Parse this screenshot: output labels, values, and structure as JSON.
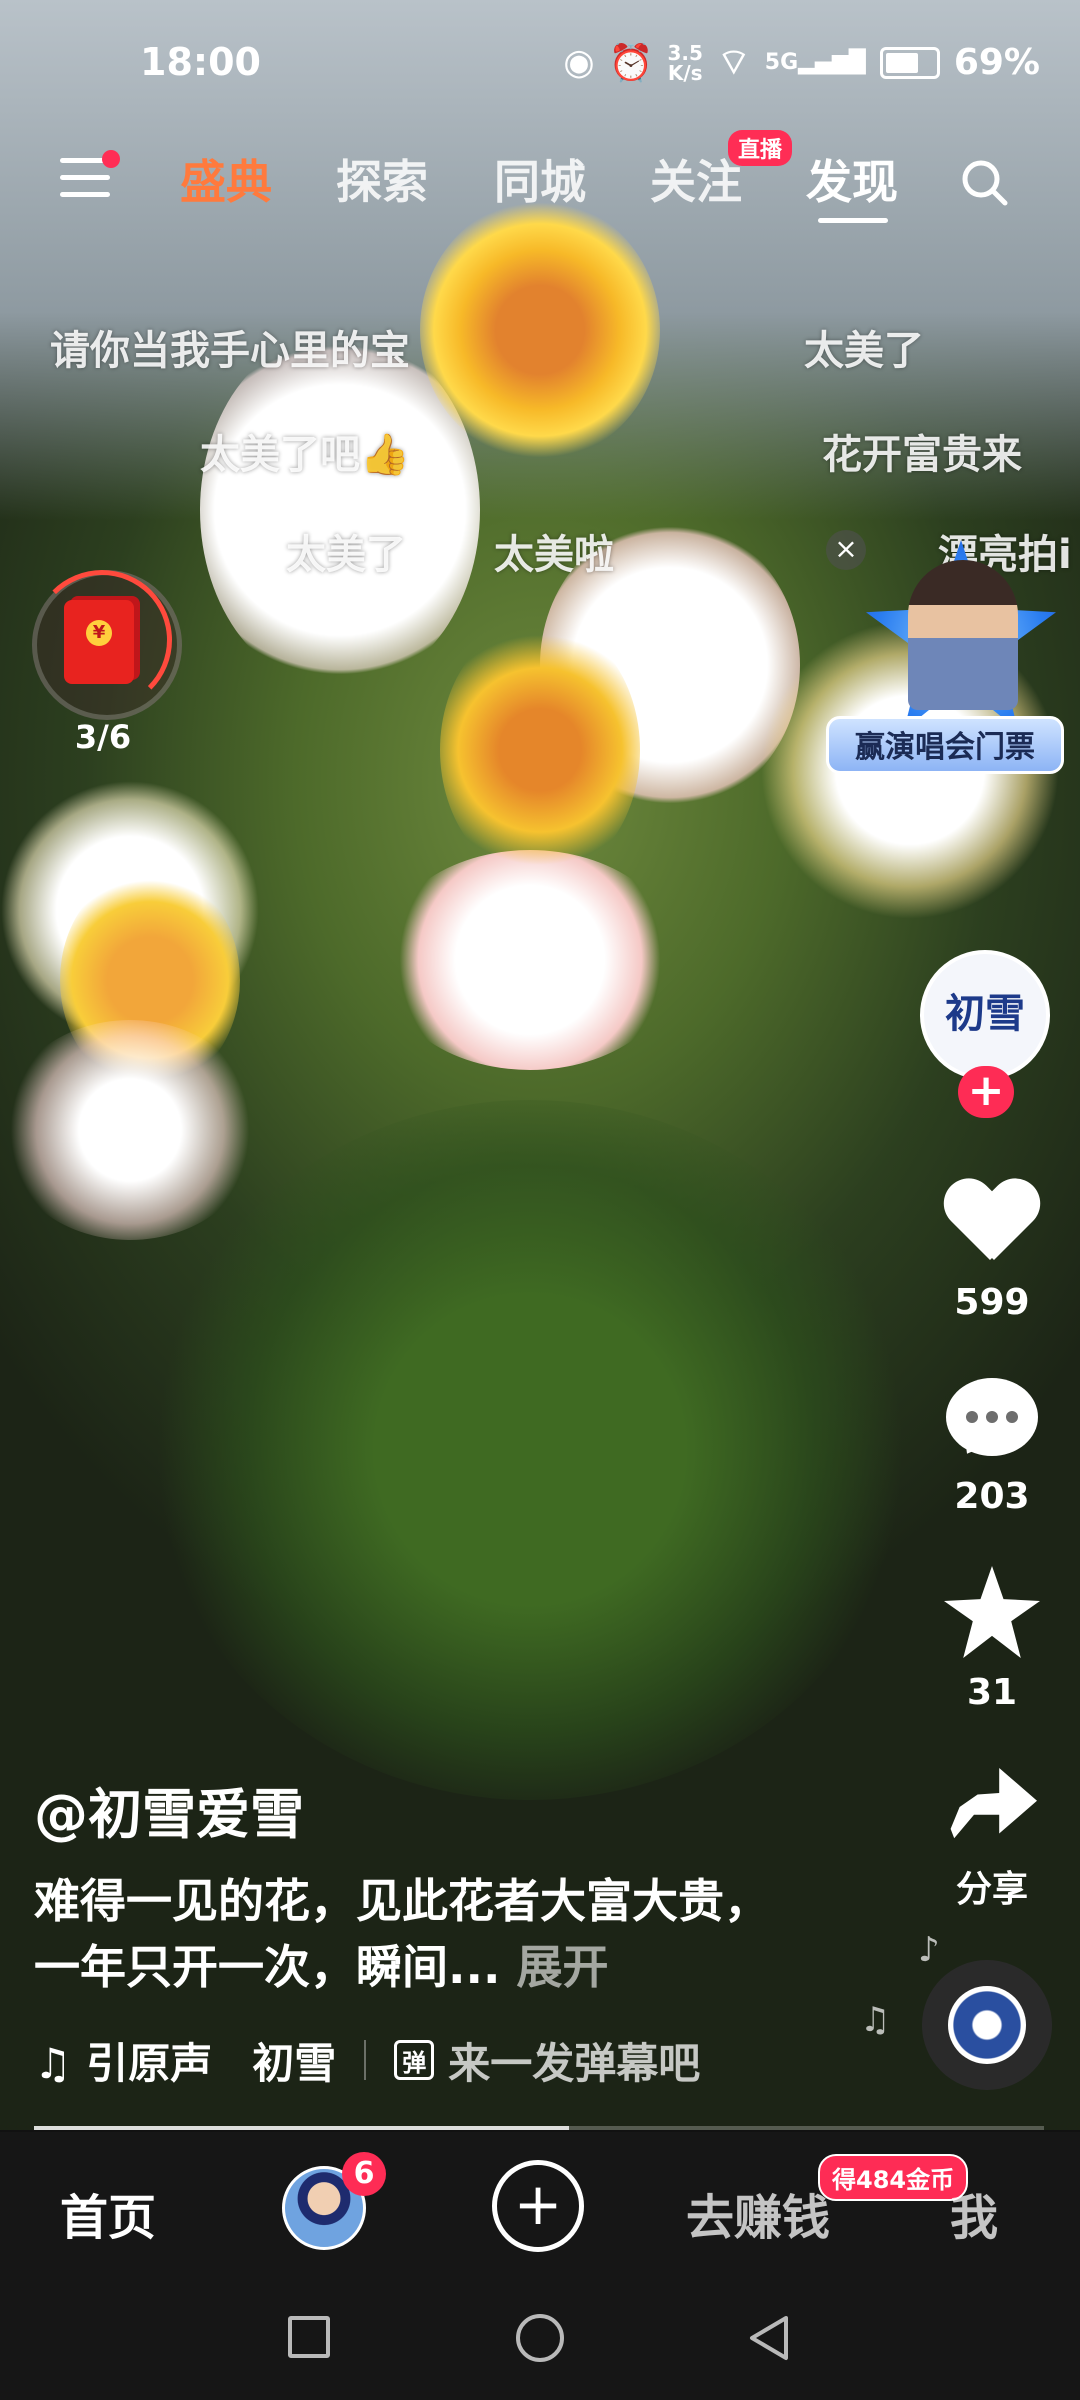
{
  "status_bar": {
    "time": "18:00",
    "speed_value": "3.5",
    "speed_unit": "K/s",
    "network": "5G",
    "battery": "69%"
  },
  "top_nav": {
    "tabs": [
      {
        "label": "盛典",
        "state": "hot"
      },
      {
        "label": "探索",
        "state": "normal"
      },
      {
        "label": "同城",
        "state": "normal"
      },
      {
        "label": "关注",
        "state": "normal"
      },
      {
        "label": "发现",
        "state": "active"
      }
    ],
    "live_badge": "直播"
  },
  "danmaku": [
    "请你当我手心里的宝",
    "太美了",
    "太美了吧👍",
    "花开富贵来",
    "太美了",
    "太美啦",
    "漂亮拍i"
  ],
  "red_packet": {
    "progress": "3/6"
  },
  "promo": {
    "label": "赢演唱会门票"
  },
  "creator": {
    "avatar_text": "初雪",
    "follow": "+"
  },
  "actions": {
    "likes": "599",
    "comments": "203",
    "favorites": "31",
    "share": "分享"
  },
  "video": {
    "author": "@初雪爱雪",
    "description": "难得一见的花，见此花者大富大贵，一年只开一次，瞬间...",
    "expand": "展开",
    "music_label": "♫ 引原声",
    "music_author": "初雪",
    "danmaku_prompt": "来一发弹幕吧",
    "danmaku_icon": "弹",
    "progress": 0.53
  },
  "bottom_nav": {
    "home": "首页",
    "friend_badge": "6",
    "create": "+",
    "earn": "去赚钱",
    "coins_badge": "得484金币",
    "me": "我"
  },
  "colors": {
    "accent": "#fe2c55",
    "hot_tab": "#ff7a3d",
    "bar_bg": "#161616"
  }
}
